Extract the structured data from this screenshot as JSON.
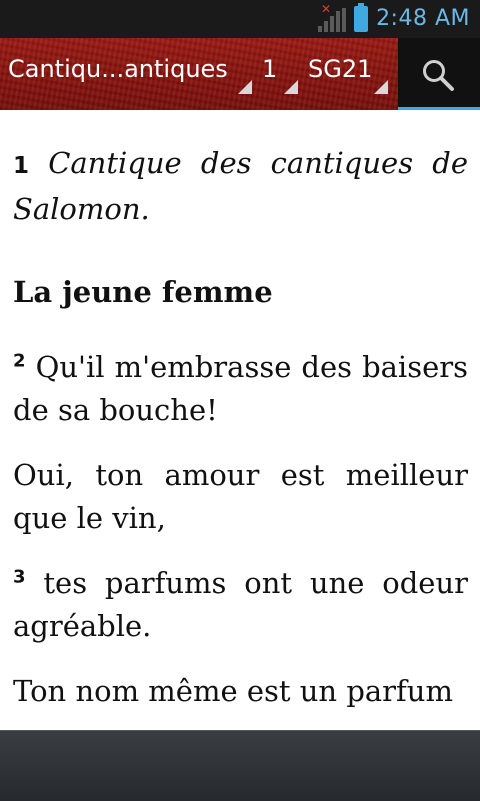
{
  "status": {
    "time": "2:48 AM"
  },
  "toolbar": {
    "book": "Cantiqu...antiques",
    "chapter": "1",
    "version": "SG21",
    "search_icon": "search-icon"
  },
  "content": {
    "v1_num": "1",
    "v1_text": "Cantique des cantiques de Salomon.",
    "heading": "La jeune femme",
    "v2_num": "2",
    "v2_text": " Qu'il m'embrasse des baisers de sa bouche!",
    "line_oui": "Oui, ton amour est meilleur que le vin,",
    "v3_num": "3",
    "v3_text": " tes parfums ont une odeur agréable.",
    "line_nom": "Ton nom même est un parfum"
  },
  "colors": {
    "accent": "#3fa9e0",
    "toolbar": "#8a140e"
  }
}
